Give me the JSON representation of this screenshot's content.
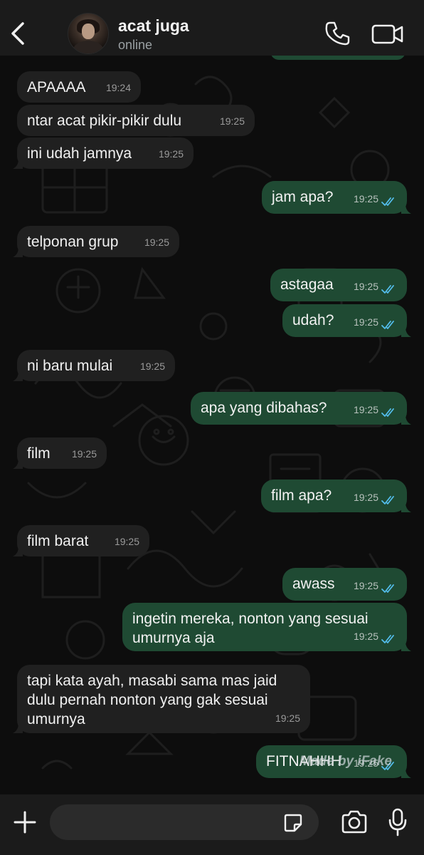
{
  "header": {
    "contact_name": "acat juga",
    "status": "online"
  },
  "messages": [
    {
      "dir": "in",
      "text": "APAAAA",
      "time": "19:24"
    },
    {
      "dir": "in",
      "text": "ntar acat pikir-pikir dulu",
      "time": "19:25"
    },
    {
      "dir": "in",
      "text": "ini udah jamnya",
      "time": "19:25"
    },
    {
      "dir": "out",
      "text": "jam apa?",
      "time": "19:25"
    },
    {
      "dir": "in",
      "text": "telponan grup",
      "time": "19:25"
    },
    {
      "dir": "out",
      "text": "astagaa",
      "time": "19:25"
    },
    {
      "dir": "out",
      "text": "udah?",
      "time": "19:25"
    },
    {
      "dir": "in",
      "text": "ni baru mulai",
      "time": "19:25"
    },
    {
      "dir": "out",
      "text": "apa yang dibahas?",
      "time": "19:25"
    },
    {
      "dir": "in",
      "text": "film",
      "time": "19:25"
    },
    {
      "dir": "out",
      "text": "film apa?",
      "time": "19:25"
    },
    {
      "dir": "in",
      "text": "film barat",
      "time": "19:25"
    },
    {
      "dir": "out",
      "text": "awass",
      "time": "19:25"
    },
    {
      "dir": "out",
      "text": "ingetin mereka, nonton yang sesuai\numurnya aja",
      "time": "19:25"
    },
    {
      "dir": "in",
      "text": "tapi kata ayah, masabi sama mas jaid\ndulu pernah nonton yang gak sesuai\numurnya",
      "time": "19:25"
    },
    {
      "dir": "out",
      "text": "FITNAHHH",
      "time": "19:25"
    }
  ],
  "watermark": "Made by iFake",
  "input": {
    "placeholder": ""
  },
  "colors": {
    "incoming_bubble": "#202020",
    "outgoing_bubble": "#1f4a33",
    "read_ticks": "#53bdeb",
    "background": "#0b0b0b"
  },
  "icons": {
    "back": "chevron-left-icon",
    "call": "phone-icon",
    "video": "video-camera-icon",
    "plus": "plus-icon",
    "sticker": "sticker-icon",
    "camera": "camera-icon",
    "mic": "microphone-icon",
    "read_receipt": "double-check-icon"
  }
}
